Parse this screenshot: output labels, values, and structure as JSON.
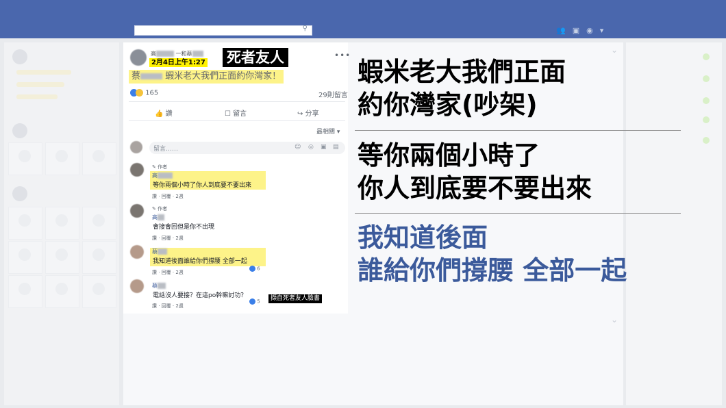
{
  "header": {
    "search_icon": "search-icon"
  },
  "post": {
    "names_prefix": "高",
    "names_mid": "一和蔡",
    "date": "2月4日上午1:27",
    "title_tag": "死者友人",
    "more_label": "•••",
    "text_prefix": "蔡",
    "text_body": "蝦米老大我們正面約你灣家！",
    "reaction_count": "165",
    "comment_count": "29則留言",
    "actions": {
      "like": "讚",
      "comment": "留言",
      "share": "分享"
    },
    "sort_label": "最相關",
    "composer_placeholder": "留言……"
  },
  "comments": [
    {
      "author_badge": "作者",
      "name": "高",
      "text": "等你兩個小時了你人到底要不要出來",
      "meta": "讚 · 回覆 · 2週"
    },
    {
      "author_badge": "作者",
      "name": "高",
      "text": "會接會回但是你不出現",
      "meta": "讚 · 回覆 · 2週"
    },
    {
      "name": "蔡",
      "text": "我知道後面誰給你們撐腰 全部一起",
      "meta": "讚 · 回覆 · 2週",
      "likes": "6"
    },
    {
      "name": "蔡",
      "text": "電話沒人要接？在這po幹嘛討功？",
      "meta": "讚 · 回覆 · 2週",
      "likes": "5"
    }
  ],
  "credit": "擷自死者友人臉書",
  "captions": {
    "line1": "蝦米老大我們正面",
    "line2": "約你灣家(吵架)",
    "line3": "等你兩個小時了",
    "line4": "你人到底要不要出來",
    "line5": "我知道後面",
    "line6": "誰給你們撐腰 全部一起"
  },
  "colors": {
    "topbar": "#4a67ad",
    "highlight": "#fdf389",
    "caption_blue": "#3b5a9b",
    "tag_yellow": "#fff200"
  }
}
